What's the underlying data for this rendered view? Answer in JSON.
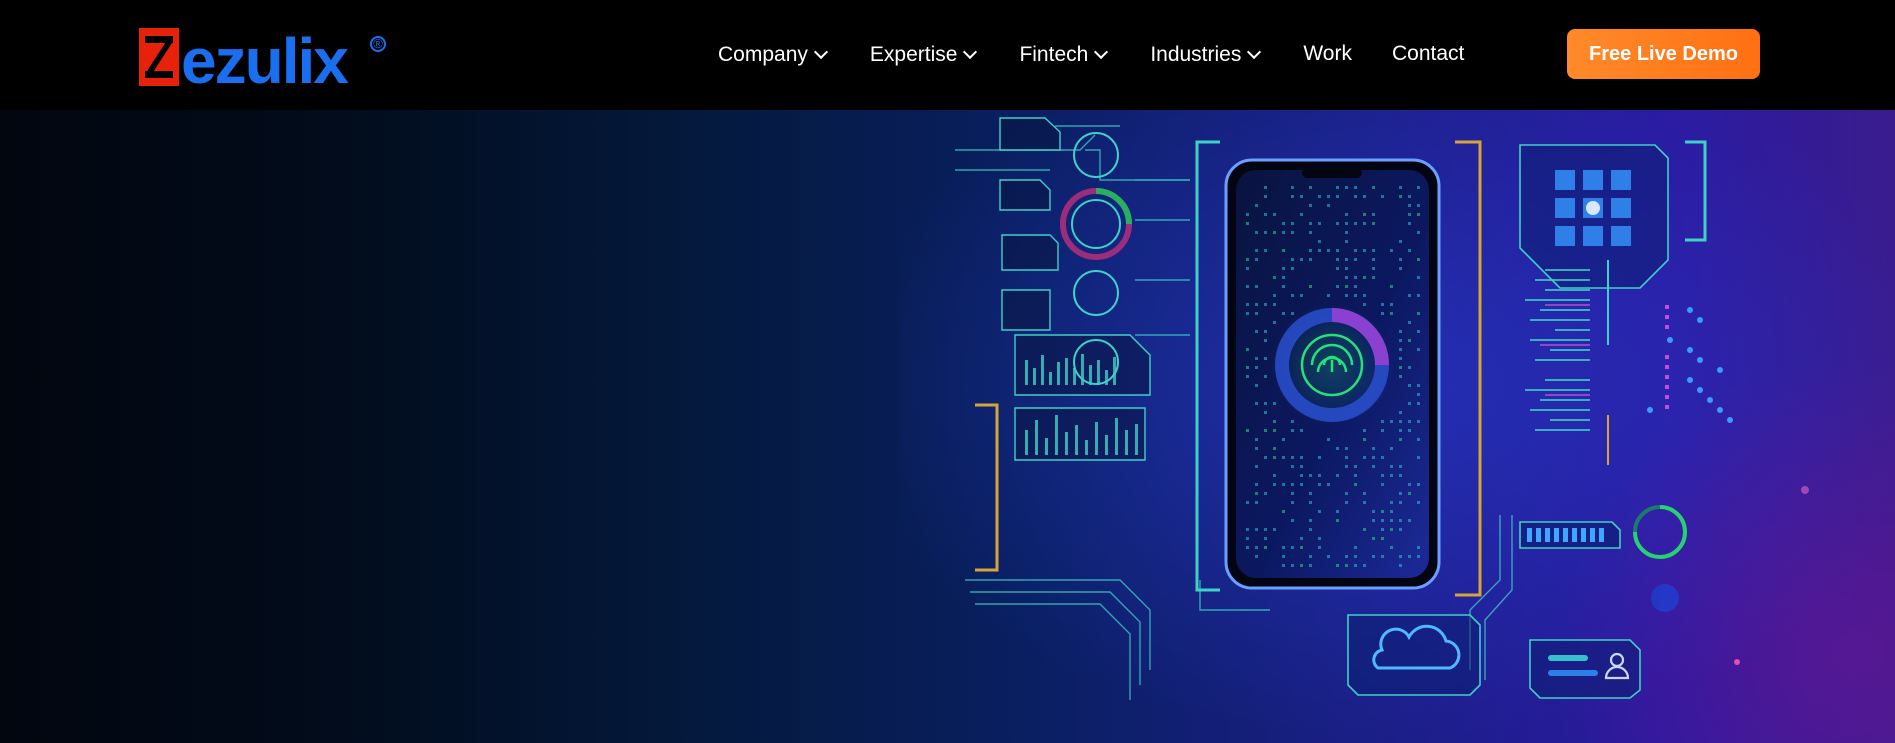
{
  "brand": {
    "logo_text": "ezulix",
    "logo_letter": "Z",
    "registered_mark": "®",
    "colors": {
      "red": "#e8210b",
      "blue": "#1a6ff0"
    }
  },
  "nav": {
    "items": [
      {
        "label": "Company",
        "has_dropdown": true
      },
      {
        "label": "Expertise",
        "has_dropdown": true
      },
      {
        "label": "Fintech",
        "has_dropdown": true
      },
      {
        "label": "Industries",
        "has_dropdown": true
      },
      {
        "label": "Work",
        "has_dropdown": false
      },
      {
        "label": "Contact",
        "has_dropdown": false
      }
    ],
    "dropdown_icon": "chevron-down-icon"
  },
  "cta": {
    "label": "Free Live Demo",
    "color": "#ff7a1f"
  },
  "hero": {
    "illustration": "phone-circuit-fintech-illustration",
    "icons": [
      "cloud-icon",
      "fingerprint-icon",
      "user-icon"
    ]
  }
}
